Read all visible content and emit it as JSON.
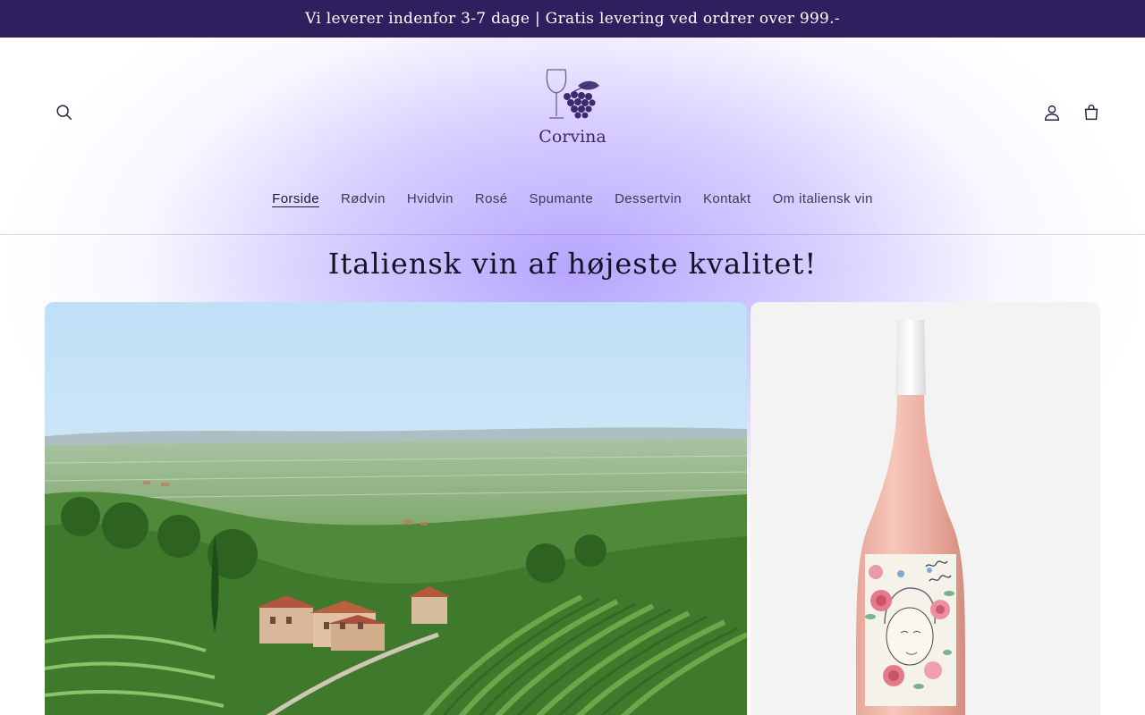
{
  "announcement": {
    "text": "Vi leverer indenfor 3-7 dage | Gratis levering ved ordrer over 999.-"
  },
  "brand": {
    "name": "Corvina"
  },
  "nav": {
    "items": [
      {
        "label": "Forside",
        "active": true
      },
      {
        "label": "Rødvin",
        "active": false
      },
      {
        "label": "Hvidvin",
        "active": false
      },
      {
        "label": "Rosé",
        "active": false
      },
      {
        "label": "Spumante",
        "active": false
      },
      {
        "label": "Dessertvin",
        "active": false
      },
      {
        "label": "Kontakt",
        "active": false
      },
      {
        "label": "Om italiensk vin",
        "active": false
      }
    ]
  },
  "hero": {
    "title": "Italiensk vin af højeste kvalitet!"
  },
  "icons": {
    "search": "search-icon",
    "account": "account-icon",
    "cart": "cart-icon"
  },
  "colors": {
    "announcement_bg": "#2f1f5e",
    "accent": "#b2a0ff",
    "text": "#161225"
  }
}
